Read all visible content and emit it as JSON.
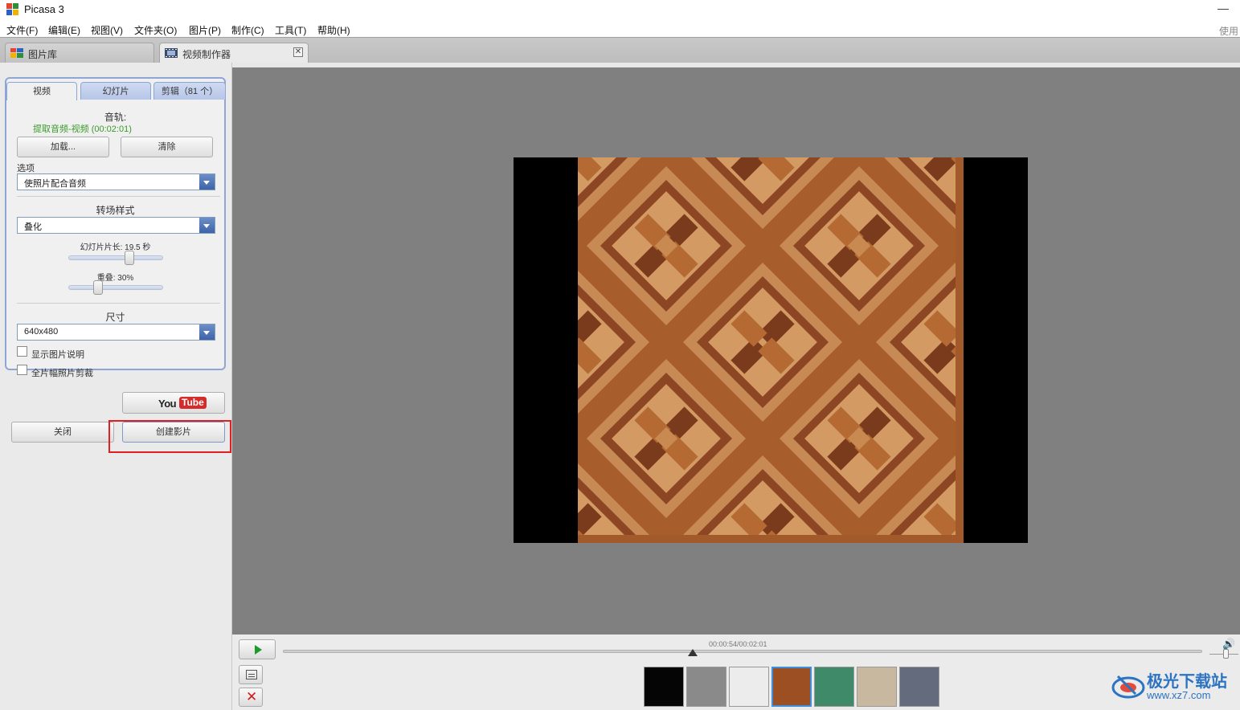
{
  "window": {
    "title": "Picasa 3",
    "minimize_glyph": "—",
    "right_clip_text": "使用"
  },
  "menu": {
    "items": [
      "文件(F)",
      "编辑(E)",
      "视图(V)",
      "文件夹(O)",
      "图片(P)",
      "制作(C)",
      "工具(T)",
      "帮助(H)"
    ]
  },
  "tabs": {
    "library": "图片库",
    "movie_maker": "视频制作器",
    "close_glyph": "✕"
  },
  "panel": {
    "tabs": {
      "video": "视频",
      "slideshow": "幻灯片",
      "clips": "剪辑（81 个）"
    },
    "audio_track_label": "音轨:",
    "audio_track_value": "提取音频-视频 (00:02:01)",
    "load_button": "加载...",
    "clear_button": "清除",
    "options_label": "选项",
    "options_value": "使照片配合音频",
    "transition_label": "转场样式",
    "transition_value": "叠化",
    "slide_length_label": "幻灯片片长: 19.5 秒",
    "slide_length_seconds": 19.5,
    "overlap_label": "重叠: 30%",
    "overlap_percent": 30,
    "size_label": "尺寸",
    "size_value": "640x480",
    "show_captions_label": "显示图片说明",
    "show_captions_checked": false,
    "full_frame_crop_label": "全片幅照片剪裁",
    "full_frame_crop_checked": false
  },
  "actions": {
    "youtube_you": "You",
    "youtube_tube": "Tube",
    "close_button": "关闭",
    "create_movie_button": "创建影片"
  },
  "player": {
    "time_readout": "00:00:54/00:02:01",
    "progress_fraction": 0.446,
    "thumbnails": [
      {
        "name": "clip-black-title",
        "color": "#050505",
        "selected": false
      },
      {
        "name": "clip-bw-photo",
        "color": "#8a8a8a",
        "selected": false
      },
      {
        "name": "clip-white-texture",
        "color": "#ececec",
        "selected": false
      },
      {
        "name": "clip-parquet",
        "color": "#9c4f22",
        "selected": true
      },
      {
        "name": "clip-green-marble",
        "color": "#3f8a68",
        "selected": false
      },
      {
        "name": "clip-beige-texture",
        "color": "#c9b8a0",
        "selected": false
      },
      {
        "name": "clip-gray-fabric",
        "color": "#646b7c",
        "selected": false
      }
    ]
  },
  "watermark": {
    "title": "极光下载站",
    "url": "www.xz7.com"
  },
  "colors": {
    "accent_blue": "#8ea6d6",
    "highlight_red": "#e02020",
    "green_text": "#3a9a2a",
    "preview_bg": "#808080"
  }
}
